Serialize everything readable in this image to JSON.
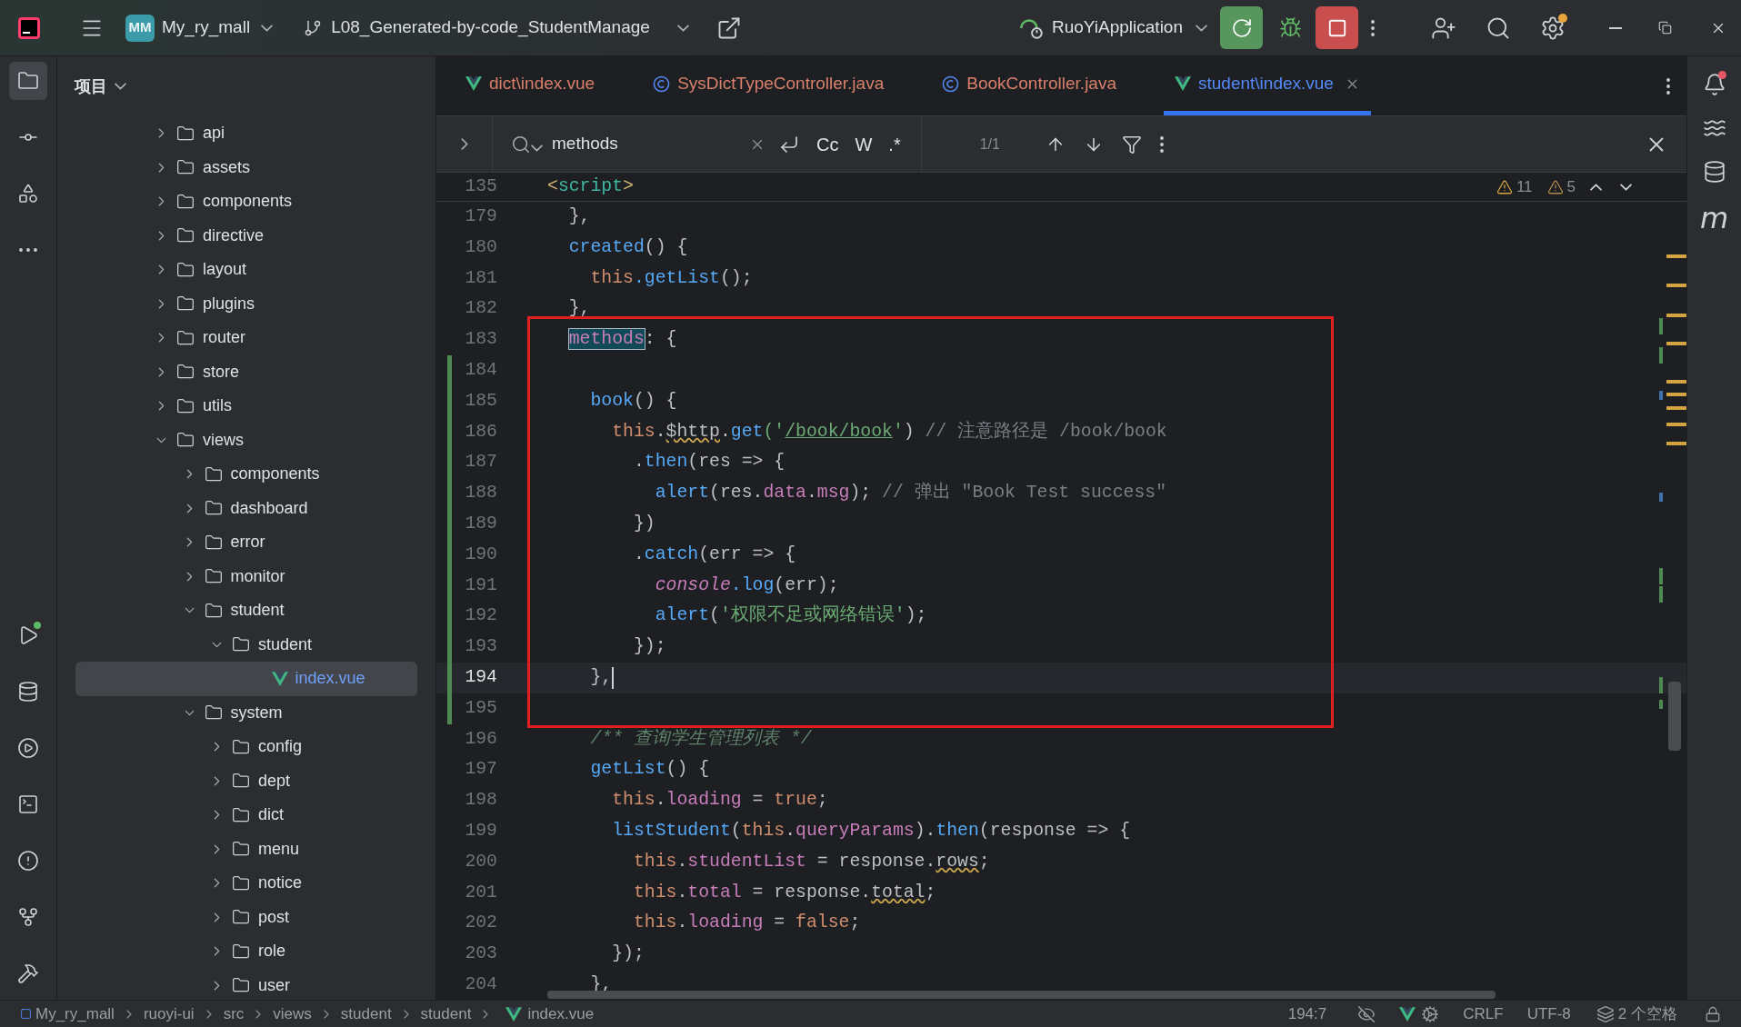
{
  "top_bar": {
    "project_badge": "MM",
    "project": "My_ry_mall",
    "branch": "L08_Generated-by-code_StudentManage",
    "run_config": "RuoYiApplication"
  },
  "left_toolbar": {
    "top": [
      {
        "kind": "project",
        "selected": true
      },
      {
        "kind": "commit",
        "selected": false
      },
      {
        "kind": "structure",
        "selected": false
      },
      {
        "kind": "more",
        "selected": false
      }
    ],
    "bottom": [
      {
        "kind": "run",
        "selected": false
      },
      {
        "kind": "database",
        "selected": false
      },
      {
        "kind": "services",
        "selected": false
      },
      {
        "kind": "terminal",
        "selected": false
      },
      {
        "kind": "problems",
        "selected": false
      },
      {
        "kind": "git",
        "selected": false
      },
      {
        "kind": "build",
        "selected": false
      }
    ]
  },
  "project_panel": {
    "title": "项目",
    "tree": [
      {
        "name": "api",
        "kind": "folder",
        "expanded": false,
        "selected": false
      },
      {
        "name": "assets",
        "kind": "folder",
        "expanded": false,
        "selected": false
      },
      {
        "name": "components",
        "kind": "folder",
        "expanded": false,
        "selected": false
      },
      {
        "name": "directive",
        "kind": "folder",
        "expanded": false,
        "selected": false
      },
      {
        "name": "layout",
        "kind": "folder",
        "expanded": false,
        "selected": false
      },
      {
        "name": "plugins",
        "kind": "folder",
        "expanded": false,
        "selected": false
      },
      {
        "name": "router",
        "kind": "folder",
        "expanded": false,
        "selected": false
      },
      {
        "name": "store",
        "kind": "folder",
        "expanded": false,
        "selected": false
      },
      {
        "name": "utils",
        "kind": "folder",
        "expanded": false,
        "selected": false
      },
      {
        "name": "views",
        "kind": "folder",
        "expanded": true,
        "selected": false,
        "children": [
          {
            "name": "components",
            "kind": "folder",
            "expanded": false,
            "selected": false
          },
          {
            "name": "dashboard",
            "kind": "folder",
            "expanded": false,
            "selected": false
          },
          {
            "name": "error",
            "kind": "folder",
            "expanded": false,
            "selected": false
          },
          {
            "name": "monitor",
            "kind": "folder",
            "expanded": false,
            "selected": false
          },
          {
            "name": "student",
            "kind": "folder",
            "expanded": true,
            "selected": false,
            "children": [
              {
                "name": "student",
                "kind": "folder",
                "expanded": true,
                "selected": false,
                "children": [
                  {
                    "name": "index.vue",
                    "kind": "vue",
                    "selected": true
                  }
                ]
              }
            ]
          },
          {
            "name": "system",
            "kind": "folder",
            "expanded": true,
            "selected": false,
            "children": [
              {
                "name": "config",
                "kind": "folder",
                "expanded": false,
                "selected": false
              },
              {
                "name": "dept",
                "kind": "folder",
                "expanded": false,
                "selected": false
              },
              {
                "name": "dict",
                "kind": "folder",
                "expanded": false,
                "selected": false
              },
              {
                "name": "menu",
                "kind": "folder",
                "expanded": false,
                "selected": false
              },
              {
                "name": "notice",
                "kind": "folder",
                "expanded": false,
                "selected": false
              },
              {
                "name": "post",
                "kind": "folder",
                "expanded": false,
                "selected": false
              },
              {
                "name": "role",
                "kind": "folder",
                "expanded": false,
                "selected": false
              },
              {
                "name": "user",
                "kind": "folder",
                "expanded": false,
                "selected": false
              }
            ]
          }
        ]
      }
    ]
  },
  "tabs": [
    {
      "label": "dict\\index.vue",
      "kind": "vue",
      "color": "#d9806b",
      "selected": false
    },
    {
      "label": "SysDictTypeController.java",
      "kind": "java",
      "color": "#d9806b",
      "selected": false
    },
    {
      "label": "BookController.java",
      "kind": "java",
      "color": "#d9806b",
      "selected": false
    },
    {
      "label": "student\\index.vue",
      "kind": "vue",
      "color": "#548af7",
      "selected": true
    }
  ],
  "find_bar": {
    "query": "methods",
    "options": [
      "Cc",
      "W",
      ".*"
    ],
    "count": "1/1"
  },
  "inspections": [
    "11",
    "5"
  ],
  "sticky_line": {
    "number": "135",
    "tokens": [
      {
        "text": "<",
        "kind": "bracket"
      },
      {
        "text": "script",
        "kind": "tag"
      },
      {
        "text": ">",
        "kind": "bracket"
      }
    ]
  },
  "lines": [
    {
      "number": "179",
      "current": false,
      "changed": false,
      "tokens": [
        {
          "text": "  },",
          "kind": "plain"
        }
      ]
    },
    {
      "number": "180",
      "current": false,
      "changed": false,
      "tokens": [
        {
          "text": "  created",
          "kind": "fn"
        },
        {
          "text": "() {",
          "kind": "plain"
        }
      ]
    },
    {
      "number": "181",
      "current": false,
      "changed": false,
      "tokens": [
        {
          "text": "    this",
          "kind": "kw"
        },
        {
          "text": ".getList",
          "kind": "fn"
        },
        {
          "text": "();",
          "kind": "plain"
        }
      ]
    },
    {
      "number": "182",
      "current": false,
      "changed": false,
      "tokens": [
        {
          "text": "  },",
          "kind": "plain"
        }
      ]
    },
    {
      "number": "183",
      "current": false,
      "changed": false,
      "tokens": [
        {
          "text": "  methods",
          "kind": "match"
        },
        {
          "text": ": {",
          "kind": "plain"
        }
      ]
    },
    {
      "number": "184",
      "current": false,
      "changed": true
    },
    {
      "number": "185",
      "current": false,
      "changed": true,
      "tokens": [
        {
          "text": "    book",
          "kind": "fn"
        },
        {
          "text": "() {",
          "kind": "plain"
        }
      ]
    },
    {
      "number": "186",
      "current": false,
      "changed": true,
      "tokens": [
        {
          "text": "      this",
          "kind": "kw"
        },
        {
          "text": ".",
          "kind": "plain"
        },
        {
          "text": "$http",
          "kind": "warn"
        },
        {
          "text": ".",
          "kind": "plain"
        },
        {
          "text": "get",
          "kind": "fn"
        },
        {
          "text": "('",
          "kind": "str"
        },
        {
          "text": "/book/book",
          "kind": "link"
        },
        {
          "text": "'",
          "kind": "str"
        },
        {
          "text": ") ",
          "kind": "plain"
        },
        {
          "text": "// 注意路径是 /book/book",
          "kind": "comment"
        }
      ]
    },
    {
      "number": "187",
      "current": false,
      "changed": true,
      "tokens": [
        {
          "text": "        .",
          "kind": "plain"
        },
        {
          "text": "then",
          "kind": "fn"
        },
        {
          "text": "(res => {",
          "kind": "plain"
        }
      ]
    },
    {
      "number": "188",
      "current": false,
      "changed": true,
      "tokens": [
        {
          "text": "          alert",
          "kind": "fn"
        },
        {
          "text": "(res.",
          "kind": "plain"
        },
        {
          "text": "data",
          "kind": "prop"
        },
        {
          "text": ".",
          "kind": "plain"
        },
        {
          "text": "msg",
          "kind": "prop"
        },
        {
          "text": "); ",
          "kind": "plain"
        },
        {
          "text": "// 弹出 \"Book Test success\"",
          "kind": "comment"
        }
      ]
    },
    {
      "number": "189",
      "current": false,
      "changed": true,
      "tokens": [
        {
          "text": "        })",
          "kind": "plain"
        }
      ]
    },
    {
      "number": "190",
      "current": false,
      "changed": true,
      "tokens": [
        {
          "text": "        .",
          "kind": "plain"
        },
        {
          "text": "catch",
          "kind": "fn"
        },
        {
          "text": "(err => {",
          "kind": "plain"
        }
      ]
    },
    {
      "number": "191",
      "current": false,
      "changed": true,
      "tokens": [
        {
          "text": "          console",
          "kind": "global"
        },
        {
          "text": ".log",
          "kind": "fn"
        },
        {
          "text": "(err);",
          "kind": "plain"
        }
      ]
    },
    {
      "number": "192",
      "current": false,
      "changed": true,
      "tokens": [
        {
          "text": "          alert",
          "kind": "fn"
        },
        {
          "text": "(",
          "kind": "plain"
        },
        {
          "text": "'权限不足或网络错误'",
          "kind": "str"
        },
        {
          "text": ");",
          "kind": "plain"
        }
      ]
    },
    {
      "number": "193",
      "current": false,
      "changed": true,
      "tokens": [
        {
          "text": "        });",
          "kind": "plain"
        }
      ]
    },
    {
      "number": "194",
      "current": true,
      "changed": true,
      "tokens": [
        {
          "text": "    },",
          "kind": "plain"
        }
      ]
    },
    {
      "number": "195",
      "current": false,
      "changed": true
    },
    {
      "number": "196",
      "current": false,
      "changed": false,
      "tokens": [
        {
          "text": "    /** 查询学生管理列表 */",
          "kind": "doc"
        }
      ]
    },
    {
      "number": "197",
      "current": false,
      "changed": false,
      "tokens": [
        {
          "text": "    getList",
          "kind": "fn"
        },
        {
          "text": "() {",
          "kind": "plain"
        }
      ]
    },
    {
      "number": "198",
      "current": false,
      "changed": false,
      "tokens": [
        {
          "text": "      this",
          "kind": "kw"
        },
        {
          "text": ".",
          "kind": "plain"
        },
        {
          "text": "loading",
          "kind": "prop"
        },
        {
          "text": " = ",
          "kind": "plain"
        },
        {
          "text": "true",
          "kind": "kw"
        },
        {
          "text": ";",
          "kind": "plain"
        }
      ]
    },
    {
      "number": "199",
      "current": false,
      "changed": false,
      "tokens": [
        {
          "text": "      listStudent",
          "kind": "fn"
        },
        {
          "text": "(",
          "kind": "plain"
        },
        {
          "text": "this",
          "kind": "kw"
        },
        {
          "text": ".",
          "kind": "plain"
        },
        {
          "text": "queryParams",
          "kind": "prop"
        },
        {
          "text": ").",
          "kind": "plain"
        },
        {
          "text": "then",
          "kind": "fn"
        },
        {
          "text": "(response => {",
          "kind": "plain"
        }
      ]
    },
    {
      "number": "200",
      "current": false,
      "changed": false,
      "tokens": [
        {
          "text": "        this",
          "kind": "kw"
        },
        {
          "text": ".",
          "kind": "plain"
        },
        {
          "text": "studentList",
          "kind": "prop"
        },
        {
          "text": " = response.",
          "kind": "plain"
        },
        {
          "text": "rows",
          "kind": "warn"
        },
        {
          "text": ";",
          "kind": "plain"
        }
      ]
    },
    {
      "number": "201",
      "current": false,
      "changed": false,
      "tokens": [
        {
          "text": "        this",
          "kind": "kw"
        },
        {
          "text": ".",
          "kind": "plain"
        },
        {
          "text": "total",
          "kind": "prop"
        },
        {
          "text": " = response.",
          "kind": "plain"
        },
        {
          "text": "total",
          "kind": "warn"
        },
        {
          "text": ";",
          "kind": "plain"
        }
      ]
    },
    {
      "number": "202",
      "current": false,
      "changed": false,
      "tokens": [
        {
          "text": "        this",
          "kind": "kw"
        },
        {
          "text": ".",
          "kind": "plain"
        },
        {
          "text": "loading",
          "kind": "prop"
        },
        {
          "text": " = ",
          "kind": "plain"
        },
        {
          "text": "false",
          "kind": "kw"
        },
        {
          "text": ";",
          "kind": "plain"
        }
      ]
    },
    {
      "number": "203",
      "current": false,
      "changed": false,
      "tokens": [
        {
          "text": "      });",
          "kind": "plain"
        }
      ]
    },
    {
      "number": "204",
      "current": false,
      "changed": false,
      "tokens": [
        {
          "text": "    },",
          "kind": "plain"
        }
      ]
    }
  ],
  "right_toolbar": {
    "maven": "m"
  },
  "status_bar": {
    "breadcrumbs": [
      {
        "text": "My_ry_mall",
        "kind": "module"
      },
      {
        "text": "ruoyi-ui",
        "kind": "folder"
      },
      {
        "text": "src",
        "kind": "folder"
      },
      {
        "text": "views",
        "kind": "folder"
      },
      {
        "text": "student",
        "kind": "folder"
      },
      {
        "text": "student",
        "kind": "folder"
      },
      {
        "text": "index.vue",
        "kind": "vue"
      }
    ],
    "position": "194:7",
    "line_ending": "CRLF",
    "encoding": "UTF-8",
    "indent": "2 个空格"
  }
}
